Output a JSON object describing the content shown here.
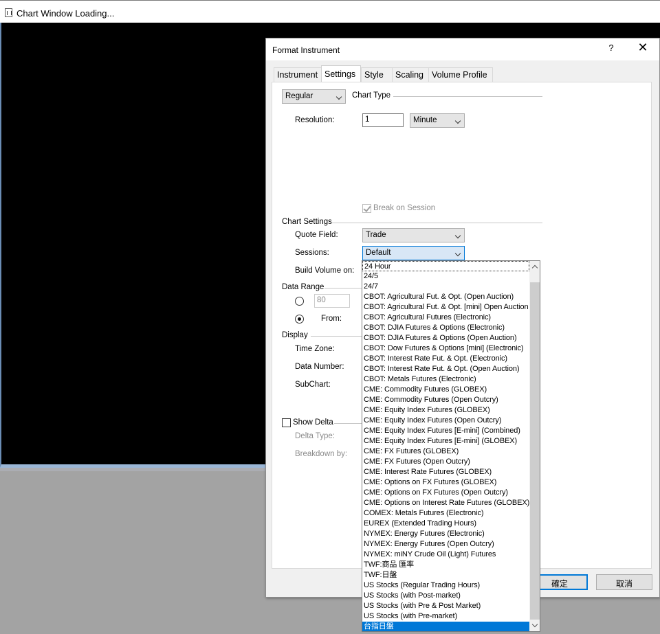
{
  "main_window": {
    "title": "Chart Window Loading..."
  },
  "dialog": {
    "title": "Format Instrument",
    "help": "?",
    "close": "✕",
    "tabs": [
      "Instrument",
      "Settings",
      "Style",
      "Scaling",
      "Volume Profile"
    ],
    "active_tab": "Settings",
    "chart_type": {
      "value": "Regular",
      "label": "Chart Type"
    },
    "resolution": {
      "label": "Resolution:",
      "value": "1",
      "unit": "Minute"
    },
    "break_on_session": {
      "label": "Break on Session",
      "checked": true,
      "disabled": true
    },
    "chart_settings": {
      "label": "Chart Settings",
      "quote_field_label": "Quote Field:",
      "quote_field_value": "Trade",
      "sessions_label": "Sessions:",
      "sessions_value": "Default",
      "build_volume_label": "Build Volume on:"
    },
    "data_range": {
      "label": "Data Range",
      "bars_value": "80",
      "from_label": "From:"
    },
    "display": {
      "label": "Display",
      "time_zone_label": "Time Zone:",
      "data_number_label": "Data Number:",
      "subchart_label": "SubChart:"
    },
    "show_delta": {
      "label": "Show Delta",
      "delta_type_label": "Delta Type:",
      "breakdown_label": "Breakdown by:"
    },
    "buttons": {
      "ok": "確定",
      "cancel": "取消"
    }
  },
  "sessions_dropdown": {
    "items": [
      "24 Hour",
      "24/5",
      "24/7",
      "CBOT: Agricultural Fut. & Opt. (Open Auction)",
      "CBOT: Agricultural Fut. & Opt. [mini] Open Auction",
      "CBOT: Agricultural Futures (Electronic)",
      "CBOT: DJIA Futures & Options (Electronic)",
      "CBOT: DJIA Futures & Options (Open Auction)",
      "CBOT: Dow Futures & Options [mini] (Electronic)",
      "CBOT: Interest Rate Fut. & Opt. (Electronic)",
      "CBOT: Interest Rate Fut. & Opt. (Open Auction)",
      "CBOT: Metals Futures (Electronic)",
      "CME: Commodity Futures (GLOBEX)",
      "CME: Commodity Futures (Open Outcry)",
      "CME: Equity Index Futures (GLOBEX)",
      "CME: Equity Index Futures (Open Outcry)",
      "CME: Equity Index Futures [E-mini] (Combined)",
      "CME: Equity Index Futures [E-mini] (GLOBEX)",
      "CME: FX Futures (GLOBEX)",
      "CME: FX Futures (Open Outcry)",
      "CME: Interest Rate Futures (GLOBEX)",
      "CME: Options on FX Futures (GLOBEX)",
      "CME: Options on FX Futures (Open Outcry)",
      "CME: Options on Interest Rate Futures (GLOBEX)",
      "COMEX: Metals Futures (Electronic)",
      "EUREX (Extended Trading Hours)",
      "NYMEX: Energy Futures (Electronic)",
      "NYMEX: Energy Futures (Open Outcry)",
      "NYMEX: miNY Crude Oil (Light) Futures",
      "TWF:商品 匯率",
      "TWF:日盤",
      "US Stocks (Regular Trading Hours)",
      "US Stocks (with Post-market)",
      "US Stocks (with Pre & Post Market)",
      "US Stocks (with Pre-market)",
      "台指日盤"
    ],
    "selected_index": 35,
    "colors": {
      "highlight": "#0078d7",
      "focus": "#0078d7"
    }
  }
}
